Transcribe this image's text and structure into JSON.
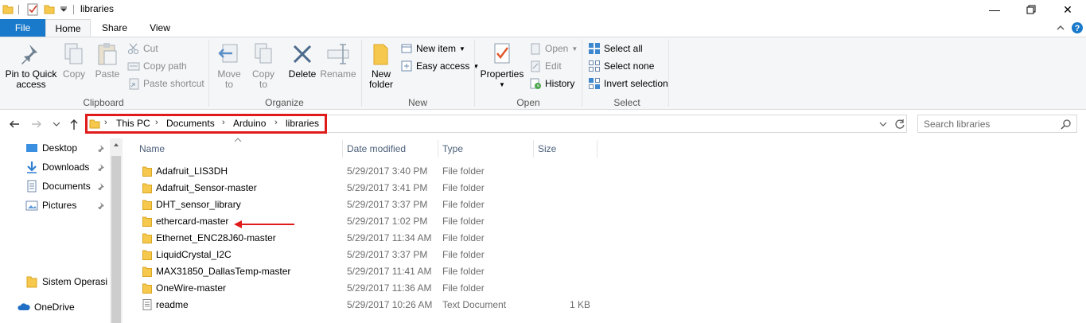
{
  "window": {
    "title": "libraries"
  },
  "ribbon_tabs": {
    "file": "File",
    "home": "Home",
    "share": "Share",
    "view": "View"
  },
  "clipboard": {
    "label": "Clipboard",
    "pin_line1": "Pin to Quick",
    "pin_line2": "access",
    "copy": "Copy",
    "paste": "Paste",
    "cut": "Cut",
    "copy_path": "Copy path",
    "paste_shortcut": "Paste shortcut"
  },
  "organize": {
    "label": "Organize",
    "move_to_line1": "Move",
    "move_to_line2": "to",
    "copy_to_line1": "Copy",
    "copy_to_line2": "to",
    "delete": "Delete",
    "rename": "Rename"
  },
  "new": {
    "label": "New",
    "new_folder_line1": "New",
    "new_folder_line2": "folder",
    "new_item": "New item",
    "easy_access": "Easy access"
  },
  "open": {
    "label": "Open",
    "properties": "Properties",
    "open": "Open",
    "edit": "Edit",
    "history": "History"
  },
  "select": {
    "label": "Select",
    "select_all": "Select all",
    "select_none": "Select none",
    "invert_selection": "Invert selection"
  },
  "address": {
    "crumbs": [
      "This PC",
      "Documents",
      "Arduino",
      "libraries"
    ]
  },
  "search": {
    "placeholder": "Search libraries"
  },
  "nav": {
    "desktop": "Desktop",
    "downloads": "Downloads",
    "documents": "Documents",
    "pictures": "Pictures",
    "sistem": "Sistem Operasi",
    "onedrive": "OneDrive"
  },
  "columns": {
    "name": "Name",
    "date": "Date modified",
    "type": "Type",
    "size": "Size"
  },
  "files": [
    {
      "name": "Adafruit_LIS3DH",
      "date": "5/29/2017 3:40 PM",
      "type": "File folder",
      "size": ""
    },
    {
      "name": "Adafruit_Sensor-master",
      "date": "5/29/2017 3:41 PM",
      "type": "File folder",
      "size": ""
    },
    {
      "name": "DHT_sensor_library",
      "date": "5/29/2017 3:37 PM",
      "type": "File folder",
      "size": ""
    },
    {
      "name": "ethercard-master",
      "date": "5/29/2017 1:02 PM",
      "type": "File folder",
      "size": ""
    },
    {
      "name": "Ethernet_ENC28J60-master",
      "date": "5/29/2017 11:34 AM",
      "type": "File folder",
      "size": ""
    },
    {
      "name": "LiquidCrystal_I2C",
      "date": "5/29/2017 3:37 PM",
      "type": "File folder",
      "size": ""
    },
    {
      "name": "MAX31850_DallasTemp-master",
      "date": "5/29/2017 11:41 AM",
      "type": "File folder",
      "size": ""
    },
    {
      "name": "OneWire-master",
      "date": "5/29/2017 11:36 AM",
      "type": "File folder",
      "size": ""
    },
    {
      "name": "readme",
      "date": "5/29/2017 10:26 AM",
      "type": "Text Document",
      "size": "1 KB"
    }
  ],
  "colors": {
    "accent": "#1979ca",
    "annotation": "#e01b1b",
    "folder": "#f6c94e"
  }
}
